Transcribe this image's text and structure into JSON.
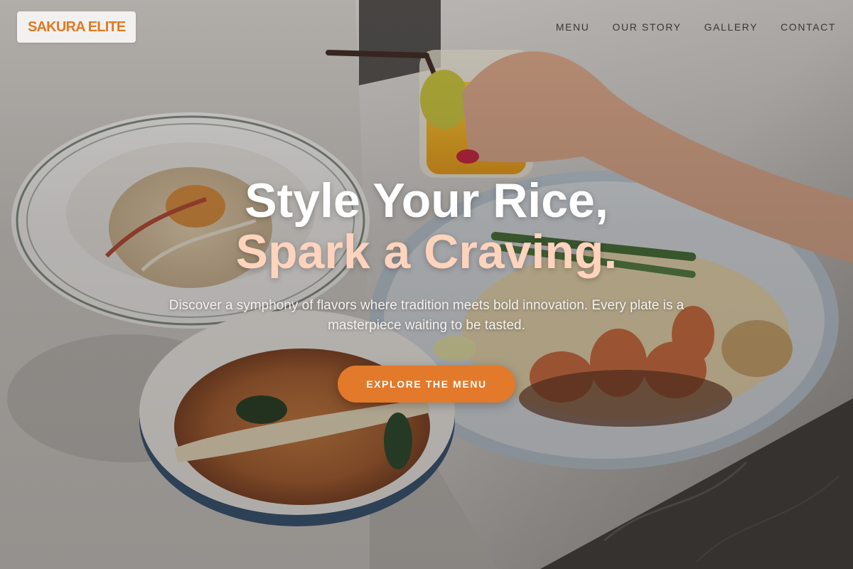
{
  "brand": {
    "name": "SAKURA ELITE"
  },
  "nav": {
    "items": [
      {
        "label": "MENU"
      },
      {
        "label": "OUR STORY"
      },
      {
        "label": "GALLERY"
      },
      {
        "label": "CONTACT"
      }
    ]
  },
  "hero": {
    "headline_line1": "Style Your Rice,",
    "headline_line2": "Spark a Craving.",
    "subtext": "Discover a symphony of flavors where tradition meets bold innovation. Every plate is a masterpiece waiting to be tasted.",
    "cta_label": "EXPLORE THE MENU"
  },
  "colors": {
    "accent": "#e3792a",
    "brand_text": "#e07a22",
    "headline_accent": "#ffd3bc"
  }
}
